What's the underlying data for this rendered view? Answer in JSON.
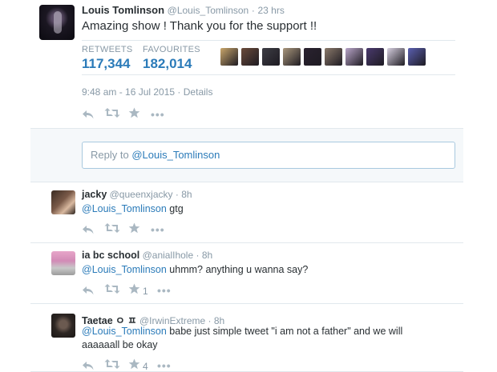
{
  "main": {
    "name": "Louis Tomlinson",
    "handle": "@Louis_Tomlinson",
    "time": "23 hrs",
    "text": "Amazing show ! Thank you for the support !!",
    "retweets_label": "RETWEETS",
    "retweets": "117,344",
    "favourites_label": "FAVOURITES",
    "favourites": "182,014",
    "timestamp": "9:48 am - 16 Jul 2015",
    "details_label": "Details",
    "faces": [
      "#c9a66b",
      "#6b4b3a",
      "#3d3d44",
      "#a9977c",
      "#2a2230",
      "#8b7a6b",
      "#b9a5c9",
      "#4a3a6e",
      "#d7d0e0",
      "#5a5fb0"
    ]
  },
  "reply_prompt": {
    "prefix": "Reply to ",
    "mention": "@Louis_Tomlinson"
  },
  "replies": [
    {
      "name": "jacky",
      "handle": "@queenxjacky",
      "time": "8h",
      "mention": "@Louis_Tomlinson",
      "text": " gtg",
      "fav_count": ""
    },
    {
      "name": "ia bc school",
      "handle": "@anialIhole",
      "time": "8h",
      "mention": "@Louis_Tomlinson",
      "text": " uhmm? anything u wanna say?",
      "fav_count": "1"
    },
    {
      "name": "Taetae ㅇ ㅍ",
      "handle": "@IrwinExtreme",
      "time": "8h",
      "mention": "@Louis_Tomlinson",
      "text": " babe just simple tweet \"i am not a father\" and we will aaaaaall be okay",
      "fav_count": "4"
    }
  ],
  "colors": {
    "link": "#2b7bb9",
    "muted": "#8899a6",
    "action": "#aab8c2"
  },
  "icons": {
    "reply": "reply-icon",
    "retweet": "retweet-icon",
    "favorite": "star-icon",
    "more": "more-icon"
  }
}
